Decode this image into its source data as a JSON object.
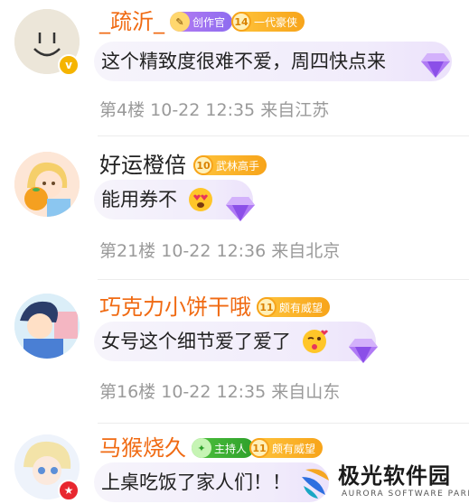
{
  "comments": [
    {
      "username": "_疏沂_",
      "badges": [
        {
          "level": "",
          "label": "创作官"
        },
        {
          "level": "14",
          "label": "一代豪侠"
        }
      ],
      "content": "这个精致度很难不爱，周四快点来",
      "floor": "第4楼",
      "datetime": "10-22 12:35",
      "location": "来自江苏",
      "vip_mark": "v"
    },
    {
      "username": "好运橙倍",
      "badges": [
        {
          "level": "10",
          "label": "武林高手"
        }
      ],
      "content": "能用券不",
      "floor": "第21楼",
      "datetime": "10-22 12:36",
      "location": "来自北京"
    },
    {
      "username": "巧克力小饼干哦",
      "badges": [
        {
          "level": "11",
          "label": "颇有威望"
        }
      ],
      "content": "女号这个细节爱了爱了",
      "floor": "第16楼",
      "datetime": "10-22 12:35",
      "location": "来自山东"
    },
    {
      "username": "马猴烧久",
      "badges": [
        {
          "level": "",
          "label": "主持人"
        },
        {
          "level": "11",
          "label": "颇有威望"
        }
      ],
      "content": "上桌吃饭了家人们！！"
    }
  ],
  "watermark": {
    "title": "极光软件园",
    "subtitle": "AURORA SOFTWARE PARK"
  },
  "colors": {
    "username_highlight": "#f06a12",
    "meta_text": "#9a9a9a",
    "bubble_start": "#f6f4fb",
    "bubble_end": "#ece2fb"
  }
}
